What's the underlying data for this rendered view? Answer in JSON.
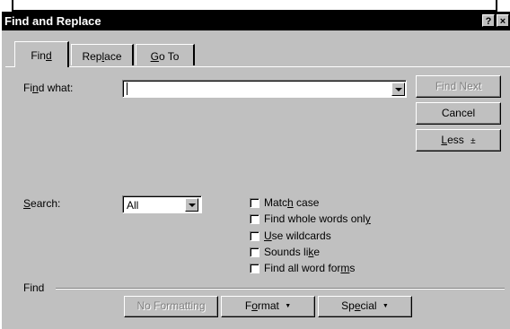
{
  "dialog": {
    "title": "Find and Replace",
    "help_label": "?",
    "close_label": "×"
  },
  "tabs": {
    "find_pre": "Fin",
    "find_u": "d",
    "find_post": "",
    "replace_pre": "Rep",
    "replace_u": "l",
    "replace_post": "ace",
    "goto_pre": "",
    "goto_u": "G",
    "goto_post": "o To"
  },
  "find_what": {
    "label_pre": "Fi",
    "label_u": "n",
    "label_post": "d what:",
    "value": ""
  },
  "buttons": {
    "find_next": "Find Next",
    "cancel": "Cancel",
    "less_u": "L",
    "less_post": "ess",
    "less_arrow": "±"
  },
  "search": {
    "label_pre": "",
    "label_u": "S",
    "label_post": "earch:",
    "value": "All"
  },
  "options": {
    "match_case": {
      "pre": "Matc",
      "u": "h",
      "post": " case"
    },
    "whole_words": {
      "pre": "Find whole words onl",
      "u": "y",
      "post": ""
    },
    "wildcards": {
      "pre": "",
      "u": "U",
      "post": "se wildcards"
    },
    "sounds_like": {
      "pre": "Sounds li",
      "u": "k",
      "post": "e"
    },
    "word_forms": {
      "pre": "Find all word for",
      "u": "m",
      "post": "s"
    }
  },
  "find_section": {
    "label": "Find",
    "no_formatting": "No Formatting",
    "format_pre": "F",
    "format_u": "o",
    "format_post": "rmat",
    "special_pre": "Sp",
    "special_u": "e",
    "special_post": "cial",
    "menu_arrow": "▼"
  }
}
